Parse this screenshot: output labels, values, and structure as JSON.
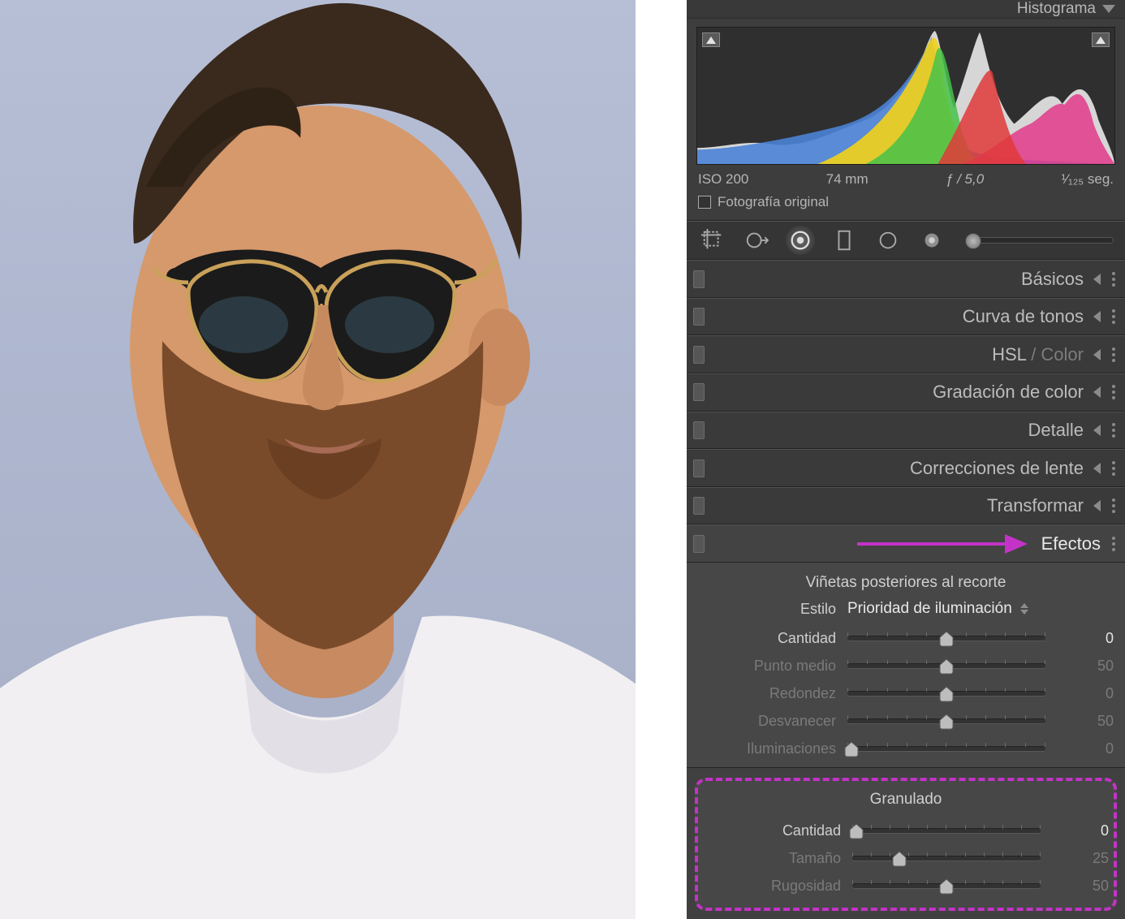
{
  "topbar": {
    "title": "Histograma"
  },
  "histogram": {
    "meta": {
      "iso": "ISO 200",
      "focal": "74 mm",
      "aperture": "ƒ / 5,0",
      "shutter": "¹⁄₁₂₅ seg."
    },
    "original_label": "Fotografía original"
  },
  "sections": {
    "basicos": "Básicos",
    "curva": "Curva de tonos",
    "hsl_a": "HSL",
    "hsl_sep": " / ",
    "hsl_b": "Color",
    "gradacion": "Gradación de color",
    "detalle": "Detalle",
    "lente": "Correcciones de lente",
    "transformar": "Transformar",
    "efectos": "Efectos"
  },
  "efectos": {
    "vignette": {
      "title": "Viñetas posteriores al recorte",
      "style_label": "Estilo",
      "style_value": "Prioridad de iluminación",
      "rows": [
        {
          "name": "Cantidad",
          "value": "0",
          "pos": 50,
          "dim": false
        },
        {
          "name": "Punto medio",
          "value": "50",
          "pos": 50,
          "dim": true
        },
        {
          "name": "Redondez",
          "value": "0",
          "pos": 50,
          "dim": true
        },
        {
          "name": "Desvanecer",
          "value": "50",
          "pos": 50,
          "dim": true
        },
        {
          "name": "Iluminaciones",
          "value": "0",
          "pos": 2,
          "dim": true
        }
      ]
    },
    "grain": {
      "title": "Granulado",
      "rows": [
        {
          "name": "Cantidad",
          "value": "0",
          "pos": 2,
          "dim": false
        },
        {
          "name": "Tamaño",
          "value": "25",
          "pos": 25,
          "dim": true
        },
        {
          "name": "Rugosidad",
          "value": "50",
          "pos": 50,
          "dim": true
        }
      ]
    }
  }
}
